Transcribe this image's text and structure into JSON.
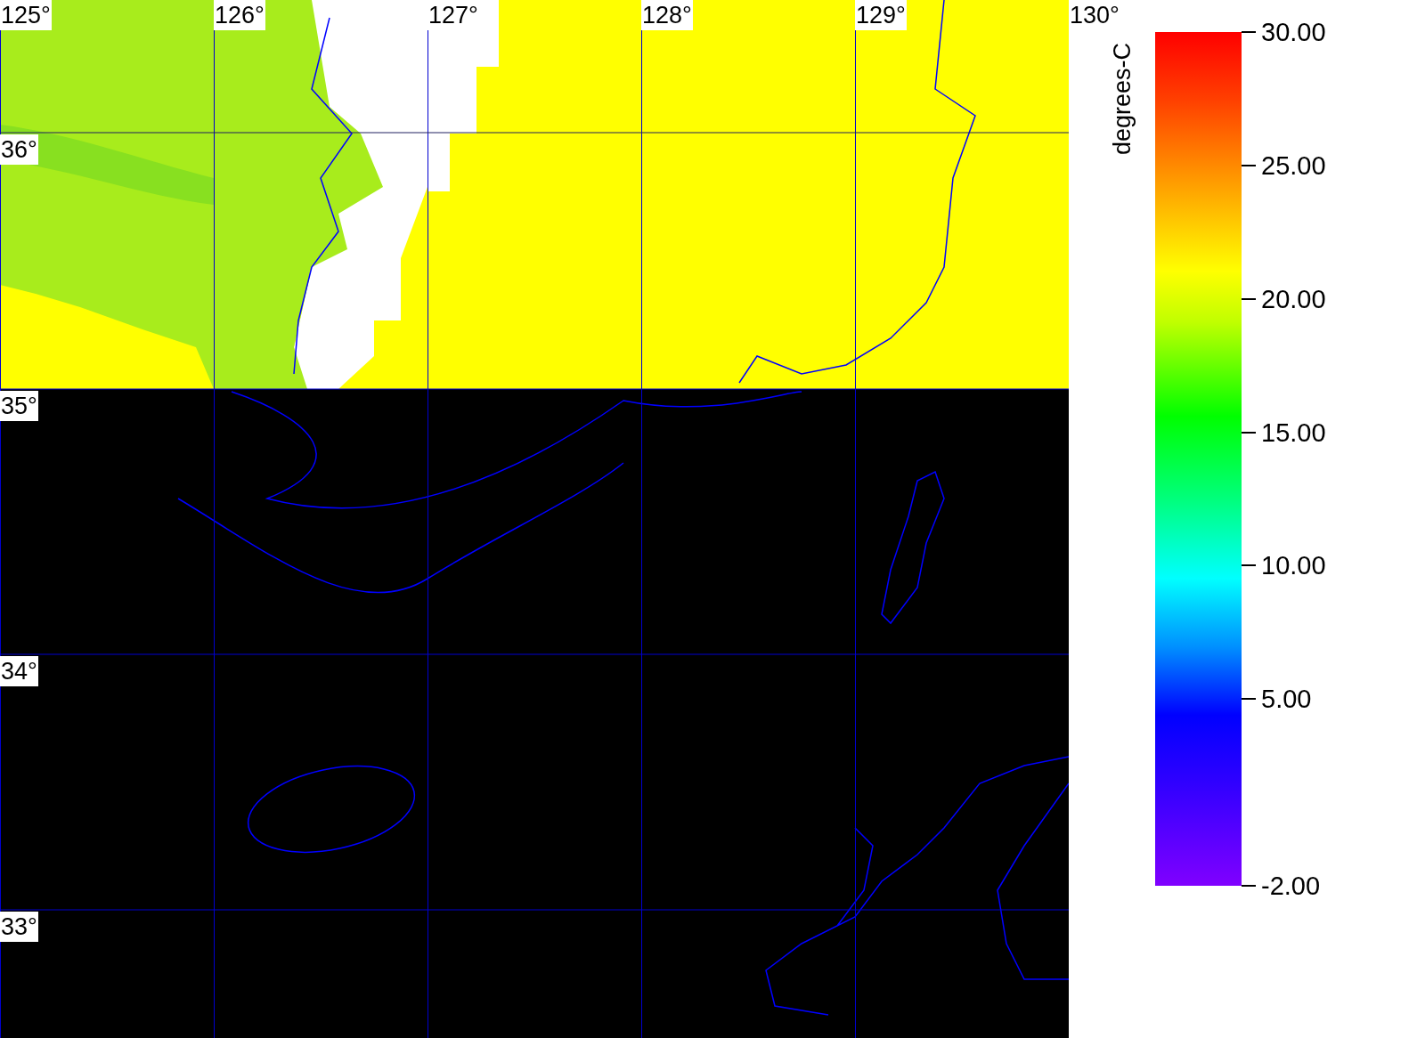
{
  "map": {
    "longitude_labels": [
      "125°",
      "126°",
      "127°",
      "128°",
      "129°",
      "130°"
    ],
    "latitude_labels": [
      "36°",
      "35°",
      "34°",
      "33°"
    ]
  },
  "colorbar": {
    "title": "degrees-C",
    "tick_labels": [
      "30.00",
      "25.00",
      "20.00",
      "15.00",
      "10.00",
      "5.00",
      "-2.00"
    ]
  }
}
